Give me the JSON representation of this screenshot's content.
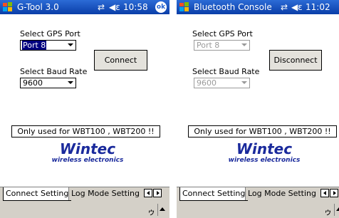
{
  "left": {
    "title": "G-Tool 3.0",
    "time": "10:58",
    "ok_label": "ok",
    "gps_label": "Select GPS Port",
    "gps_value": "Port 8",
    "baud_label": "Select Baud Rate",
    "baud_value": "9600",
    "connect_label": "Connect",
    "note": "Only used for WBT100 , WBT200 !!",
    "tab_active": "Connect Setting",
    "tab_other": "Log Mode Setting"
  },
  "right": {
    "title": "Bluetooth Console",
    "time": "11:02",
    "gps_label": "Select GPS Port",
    "gps_value": "Port 8",
    "baud_label": "Select Baud Rate",
    "baud_value": "9600",
    "disconnect_label": "Disconnect",
    "note": "Only used for WBT100 , WBT200 !!",
    "tab_active": "Connect Setting",
    "tab_other": "Log Mode Setting"
  },
  "logo": {
    "brand": "Wintec",
    "tagline": "wireless electronics",
    "color": "#1a2a9c"
  },
  "status_icons": [
    "signal-icon",
    "speaker-icon"
  ]
}
